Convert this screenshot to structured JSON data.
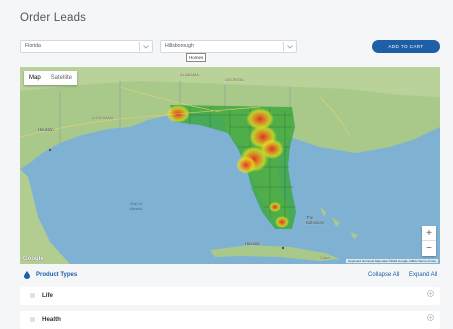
{
  "page": {
    "title": "Order Leads"
  },
  "filters": {
    "state": {
      "value": "Florida"
    },
    "county": {
      "value": "Hillsborough"
    },
    "add_to_cart_label": "ADD TO CART"
  },
  "map": {
    "type_control": {
      "map_label": "Map",
      "satellite_label": "Satellite"
    },
    "labels": {
      "alabama": "ALABAMA",
      "georgia": "GEORGIA",
      "louisiana": "LOUISIANA",
      "houston": "Houston",
      "gulf": "Gulf of Mexico",
      "bahamas": "The Bahamas",
      "havana": "Havana",
      "cuba": "Cuba"
    },
    "tooltip": "Homes",
    "zoom": {
      "in": "+",
      "out": "−"
    },
    "google": "Google",
    "attribution": "Keyboard shortcuts  Map data ©2022 Google, INEGI  Terms of Use"
  },
  "product_types": {
    "title": "Product Types",
    "collapse_all": "Collapse All",
    "expand_all": "Expand All",
    "items": [
      {
        "label": "Life"
      },
      {
        "label": "Health"
      }
    ]
  },
  "colors": {
    "accent": "#1f5fa8",
    "heat_low": "#3aa83a",
    "heat_mid": "#e8e020",
    "heat_high": "#e03020"
  },
  "icons": {
    "dropdown": "chevron-down-icon",
    "product_types": "drop-icon",
    "row_handle": "grip-icon",
    "row_toggle": "plus-circle-icon"
  }
}
